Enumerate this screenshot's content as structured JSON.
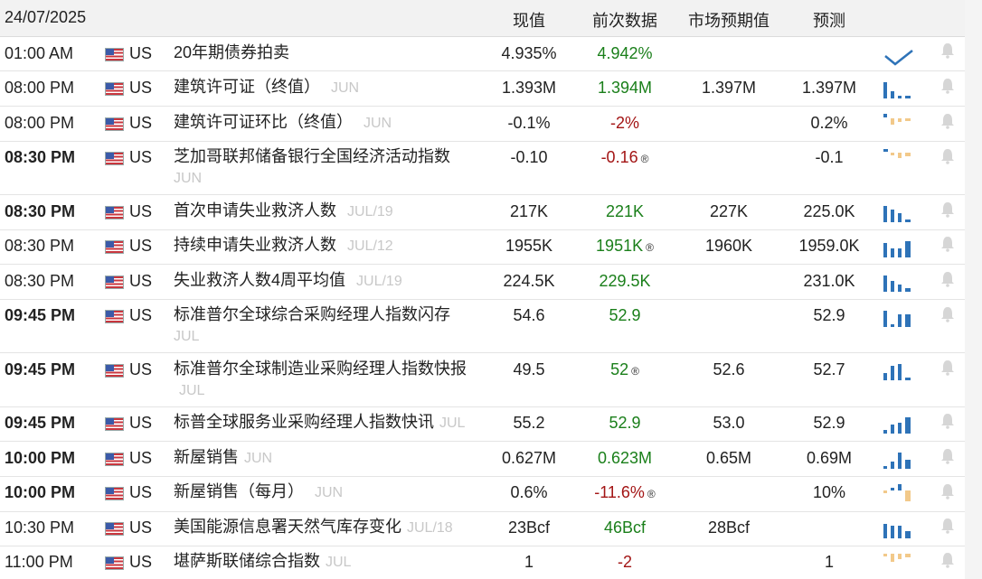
{
  "header": {
    "date": "24/07/2025",
    "col_actual": "现值",
    "col_previous": "前次数据",
    "col_consensus": "市场预期值",
    "col_forecast": "预测"
  },
  "colors": {
    "positive": "#1a7f1a",
    "negative": "#a31515",
    "spark_blue": "#2e73b8",
    "spark_amber": "#f2c98a",
    "muted": "#c8c8c8"
  },
  "rows": [
    {
      "time": "01:00 AM",
      "country": "US",
      "event": "20年期债券拍卖",
      "period": "",
      "actual": "4.935%",
      "previous": "4.942%",
      "consensus": "",
      "forecast": "",
      "spark": "check-icon"
    },
    {
      "time": "08:00 PM",
      "country": "US",
      "event": "建筑许可证（终值）",
      "period": "JUN",
      "actual": "1.393M",
      "previous": "1.394M",
      "consensus": "1.397M",
      "forecast": "1.397M",
      "spark": "bar-sparkline"
    },
    {
      "time": "08:00 PM",
      "country": "US",
      "event": "建筑许可证环比（终值）",
      "period": "JUN",
      "actual": "-0.1%",
      "previous": "-2%",
      "consensus": "",
      "forecast": "0.2%",
      "spark": "bar-sparkline"
    },
    {
      "time": "08:30 PM",
      "country": "US",
      "event": "芝加哥联邦储备银行全国经济活动指数",
      "period": "JUN",
      "actual": "-0.10",
      "previous": "-0.16",
      "consensus": "",
      "forecast": "-0.1",
      "spark": "bar-sparkline"
    },
    {
      "time": "08:30 PM",
      "country": "US",
      "event": "首次申请失业救济人数",
      "period": "JUL/19",
      "actual": "217K",
      "previous": "221K",
      "consensus": "227K",
      "forecast": "225.0K",
      "spark": "bar-sparkline"
    },
    {
      "time": "08:30 PM",
      "country": "US",
      "event": "持续申请失业救济人数",
      "period": "JUL/12",
      "actual": "1955K",
      "previous": "1951K",
      "consensus": "1960K",
      "forecast": "1959.0K",
      "spark": "bar-sparkline"
    },
    {
      "time": "08:30 PM",
      "country": "US",
      "event": "失业救济人数4周平均值",
      "period": "JUL/19",
      "actual": "224.5K",
      "previous": "229.5K",
      "consensus": "",
      "forecast": "231.0K",
      "spark": "bar-sparkline"
    },
    {
      "time": "09:45 PM",
      "country": "US",
      "event": "标准普尔全球综合采购经理人指数闪存",
      "period": "JUL",
      "actual": "54.6",
      "previous": "52.9",
      "consensus": "",
      "forecast": "52.9",
      "spark": "bar-sparkline"
    },
    {
      "time": "09:45 PM",
      "country": "US",
      "event": "标准普尔全球制造业采购经理人指数快报",
      "period": "JUL",
      "actual": "49.5",
      "previous": "52",
      "consensus": "52.6",
      "forecast": "52.7",
      "spark": "bar-sparkline"
    },
    {
      "time": "09:45 PM",
      "country": "US",
      "event": "标普全球服务业采购经理人指数快讯",
      "period": "JUL",
      "actual": "55.2",
      "previous": "52.9",
      "consensus": "53.0",
      "forecast": "52.9",
      "spark": "bar-sparkline"
    },
    {
      "time": "10:00 PM",
      "country": "US",
      "event": "新屋销售",
      "period": "JUN",
      "actual": "0.627M",
      "previous": "0.623M",
      "consensus": "0.65M",
      "forecast": "0.69M",
      "spark": "bar-sparkline"
    },
    {
      "time": "10:00 PM",
      "country": "US",
      "event": "新屋销售（每月）",
      "period": "JUN",
      "actual": "0.6%",
      "previous": "-11.6%",
      "consensus": "",
      "forecast": "10%",
      "spark": "bar-sparkline"
    },
    {
      "time": "10:30 PM",
      "country": "US",
      "event": "美国能源信息署天然气库存变化",
      "period": "JUL/18",
      "actual": "23Bcf",
      "previous": "46Bcf",
      "consensus": "28Bcf",
      "forecast": "",
      "spark": "bar-sparkline"
    },
    {
      "time": "11:00 PM",
      "country": "US",
      "event": "堪萨斯联储综合指数",
      "period": "JUL",
      "actual": "1",
      "previous": "-2",
      "consensus": "",
      "forecast": "1",
      "spark": "bar-sparkline"
    }
  ]
}
